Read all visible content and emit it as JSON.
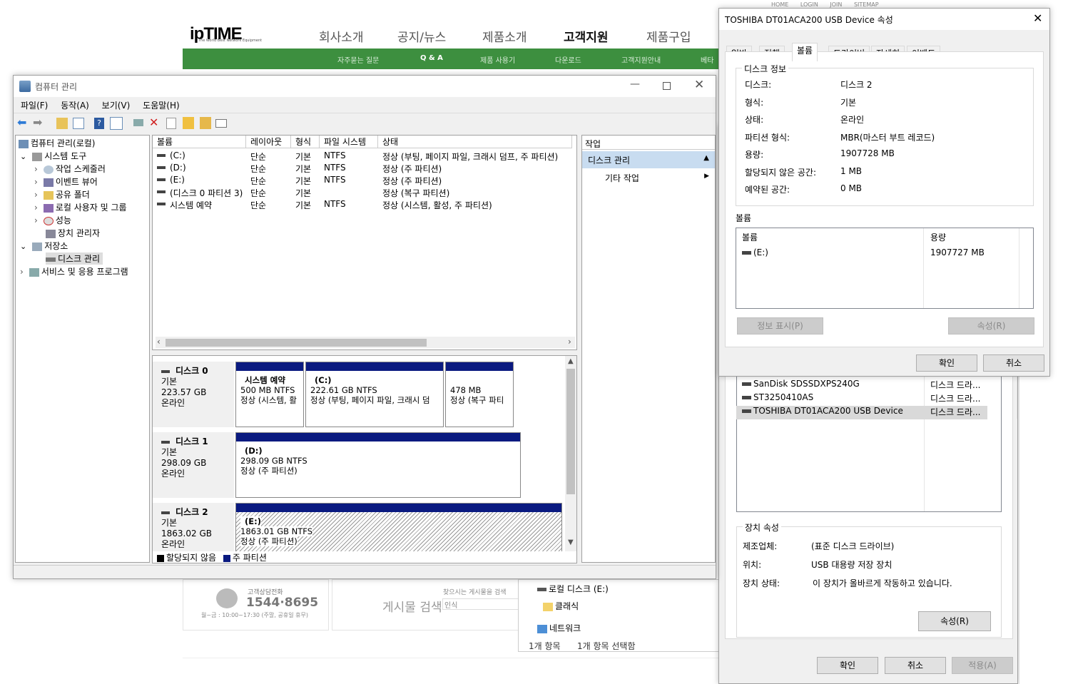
{
  "website": {
    "top_links": [
      "HOME",
      "LOGIN",
      "JOIN",
      "SITEMAP"
    ],
    "logo": "ipTIME",
    "logo_tagline": "The World Best Network Equipment",
    "nav": [
      "회사소개",
      "공지/뉴스",
      "제품소개",
      "고객지원",
      "제품구입"
    ],
    "subnav": [
      "자주묻는 질문",
      "Q & A",
      "제품 사용기",
      "다운로드",
      "고객지원안내",
      "베타"
    ],
    "phone_label": "고객상담전화",
    "phone": "1544·8695",
    "hours": "월~금 : 10:00~17:30 (주말, 공휴일 휴무)",
    "search_title": "게시물 검색",
    "search_hint": "찾으시는 게시물을 검색",
    "search_value": "인식"
  },
  "explorer_fragment": {
    "items": [
      "로컬 디스크 (E:)",
      "클래식",
      "네트워크"
    ],
    "status_count": "1개 항목",
    "status_selected": "1개 항목 선택함"
  },
  "cm": {
    "title": "컴퓨터 관리",
    "menu": [
      "파일(F)",
      "동작(A)",
      "보기(V)",
      "도움말(H)"
    ],
    "tree": [
      {
        "label": "컴퓨터 관리(로컬)",
        "level": 0,
        "expander": ""
      },
      {
        "label": "시스템 도구",
        "level": 1,
        "expander": "⌄"
      },
      {
        "label": "작업 스케줄러",
        "level": 2,
        "expander": "›"
      },
      {
        "label": "이벤트 뷰어",
        "level": 2,
        "expander": "›"
      },
      {
        "label": "공유 폴더",
        "level": 2,
        "expander": "›"
      },
      {
        "label": "로컬 사용자 및 그룹",
        "level": 2,
        "expander": "›"
      },
      {
        "label": "성능",
        "level": 2,
        "expander": "›"
      },
      {
        "label": "장치 관리자",
        "level": 2,
        "expander": ""
      },
      {
        "label": "저장소",
        "level": 1,
        "expander": "⌄"
      },
      {
        "label": "디스크 관리",
        "level": 2,
        "expander": ""
      },
      {
        "label": "서비스 및 응용 프로그램",
        "level": 1,
        "expander": "›"
      }
    ],
    "columns": [
      "볼륨",
      "레이아웃",
      "형식",
      "파일 시스템",
      "상태"
    ],
    "volumes": [
      {
        "name": "(C:)",
        "layout": "단순",
        "type": "기본",
        "fs": "NTFS",
        "status": "정상 (부팅, 페이지 파일, 크래시 덤프, 주 파티션)"
      },
      {
        "name": "(D:)",
        "layout": "단순",
        "type": "기본",
        "fs": "NTFS",
        "status": "정상 (주 파티션)"
      },
      {
        "name": "(E:)",
        "layout": "단순",
        "type": "기본",
        "fs": "NTFS",
        "status": "정상 (주 파티션)"
      },
      {
        "name": "(디스크 0 파티션 3)",
        "layout": "단순",
        "type": "기본",
        "fs": "",
        "status": "정상 (복구 파티션)"
      },
      {
        "name": "시스템 예약",
        "layout": "단순",
        "type": "기본",
        "fs": "NTFS",
        "status": "정상 (시스템, 활성, 주 파티션)"
      }
    ],
    "disks": [
      {
        "name": "디스크 0",
        "type": "기본",
        "size": "223.57 GB",
        "state": "온라인",
        "parts": [
          {
            "title": "시스템 예약",
            "size": "500 MB NTFS",
            "status": "정상 (시스템, 활"
          },
          {
            "title": "(C:)",
            "size": "222.61 GB NTFS",
            "status": "정상 (부팅, 페이지 파일, 크래시 덤"
          },
          {
            "title": "",
            "size": "478 MB",
            "status": "정상 (복구 파티"
          }
        ]
      },
      {
        "name": "디스크 1",
        "type": "기본",
        "size": "298.09 GB",
        "state": "온라인",
        "parts": [
          {
            "title": "(D:)",
            "size": "298.09 GB NTFS",
            "status": "정상 (주 파티션)"
          }
        ]
      },
      {
        "name": "디스크 2",
        "type": "기본",
        "size": "1863.02 GB",
        "state": "온라인",
        "parts": [
          {
            "title": "(E:)",
            "size": "1863.01 GB NTFS",
            "status": "정상 (주 파티션)"
          }
        ]
      }
    ],
    "legend_unallocated": "할당되지 않음",
    "legend_primary": "주 파티션",
    "actions_title": "작업",
    "actions_section": "디스크 관리",
    "actions_more": "기타 작업"
  },
  "props_back": {
    "devices": [
      {
        "name": "SanDisk SDSSDXPS240G",
        "type": "디스크 드라..."
      },
      {
        "name": "ST3250410AS",
        "type": "디스크 드라..."
      },
      {
        "name": "TOSHIBA DT01ACA200 USB Device",
        "type": "디스크 드라..."
      }
    ],
    "group_title": "장치 속성",
    "manufacturer_label": "제조업체:",
    "manufacturer": "(표준 디스크 드라이브)",
    "location_label": "위치:",
    "location": "USB 대용량 저장 장치",
    "status_label": "장치 상태:",
    "status": "이 장치가 올바르게 작동하고 있습니다.",
    "props_button": "속성(R)",
    "ok": "확인",
    "cancel": "취소",
    "apply": "적용(A)"
  },
  "props": {
    "title": "TOSHIBA DT01ACA200 USB Device 속성",
    "tabs": [
      "일반",
      "정책",
      "볼륨",
      "드라이버",
      "자세히",
      "이벤트"
    ],
    "active_tab": "볼륨",
    "disk_group": "디스크 정보",
    "fields": [
      {
        "label": "디스크:",
        "value": "디스크 2"
      },
      {
        "label": "형식:",
        "value": "기본"
      },
      {
        "label": "상태:",
        "value": "온라인"
      },
      {
        "label": "파티션 형식:",
        "value": "MBR(마스터 부트 레코드)"
      },
      {
        "label": "용량:",
        "value": "1907728 MB"
      },
      {
        "label": "할당되지 않은 공간:",
        "value": "1 MB"
      },
      {
        "label": "예약된 공간:",
        "value": "0 MB"
      }
    ],
    "volumes_label": "볼륨",
    "vol_col_name": "볼륨",
    "vol_col_size": "용량",
    "vol_name": "(E:)",
    "vol_size": "1907727 MB",
    "info_button": "정보 표시(P)",
    "props_button": "속성(R)",
    "ok": "확인",
    "cancel": "취소"
  }
}
